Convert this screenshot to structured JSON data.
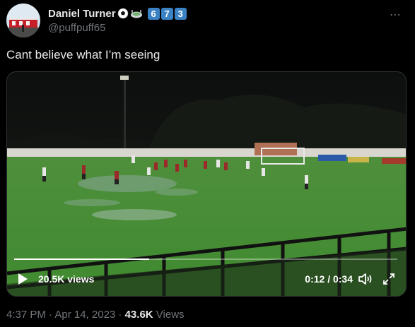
{
  "author": {
    "display_name": "Daniel Turner",
    "handle": "@puffpuff65",
    "badges": [
      "6",
      "7",
      "3"
    ],
    "emoji_icons": [
      "soccer-ball-icon",
      "stadium-icon"
    ]
  },
  "more_icon": "⋯",
  "tweet": {
    "text": "Cant believe what I’m seeing"
  },
  "video": {
    "views_label": "20.5K views",
    "time_label": "0:12 / 0:34",
    "progress": 0.353,
    "controls": [
      "play-icon",
      "volume-icon",
      "fullscreen-icon"
    ]
  },
  "meta": {
    "timestamp": "4:37 PM · Apr 14, 2023 · ",
    "views_count": "43.6K",
    "views_word": " Views"
  },
  "colors": {
    "background": "#000000",
    "text_primary": "#e7e9ea",
    "text_secondary": "#71767b",
    "badge_blue": "#3b82c4",
    "border": "#2f3336"
  }
}
